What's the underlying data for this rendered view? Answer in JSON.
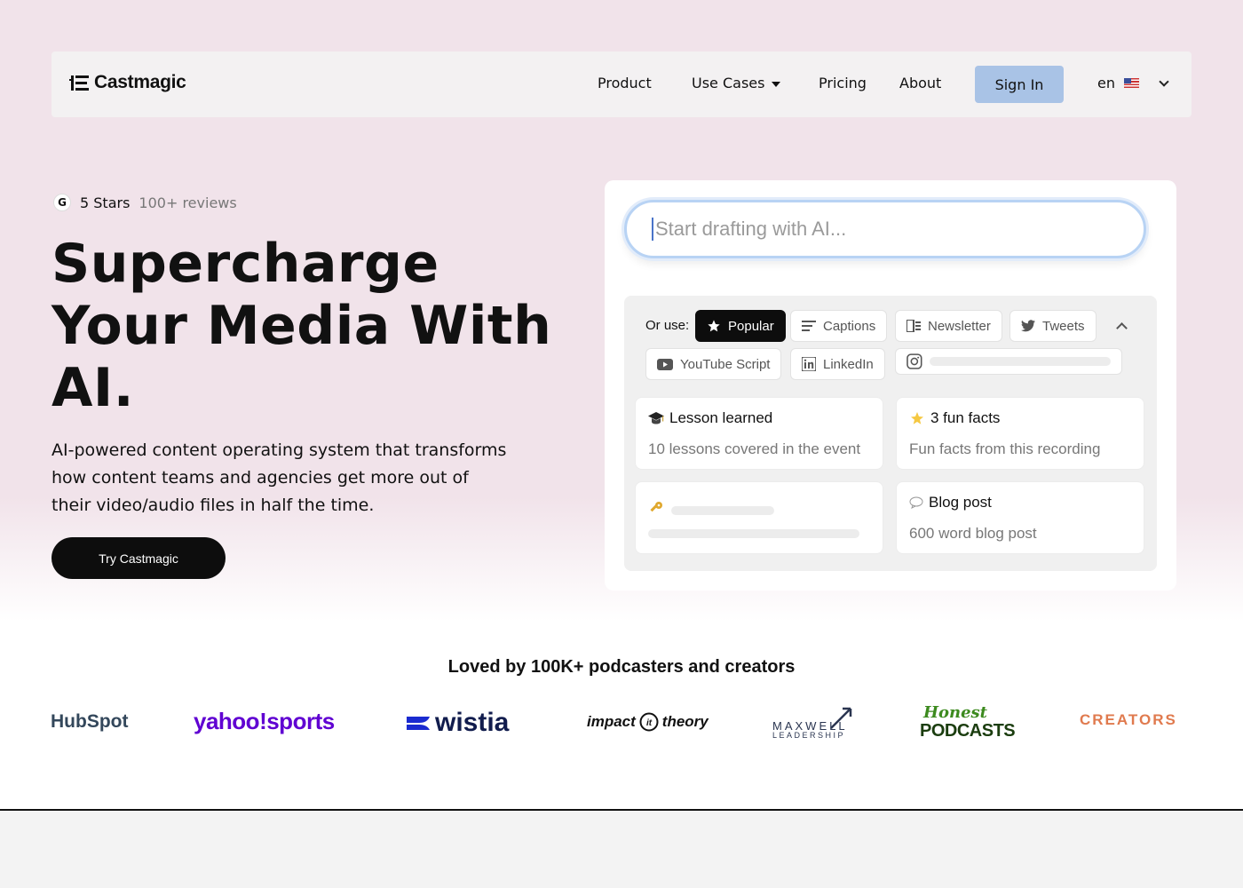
{
  "nav": {
    "brand": "Castmagic",
    "links": [
      "Product",
      "Use Cases",
      "Pricing",
      "About"
    ],
    "signin": "Sign In",
    "lang": "en"
  },
  "hero": {
    "rating_stars": "5 Stars",
    "rating_reviews": "100+ reviews",
    "headline_1": "Supercharge",
    "headline_2": "Your Media With",
    "headline_3": "AI.",
    "subtitle": "AI-powered content operating system that transforms how content teams and agencies get more out of their video/audio files in half the time.",
    "cta": "Try Castmagic"
  },
  "composer": {
    "placeholder": "Start drafting with AI...",
    "or_use": "Or use:",
    "chips": {
      "popular": "Popular",
      "captions": "Captions",
      "newsletter": "Newsletter",
      "tweets": "Tweets",
      "youtube": "YouTube Script",
      "linkedin": "LinkedIn"
    },
    "tiles": {
      "lesson_title": "Lesson learned",
      "lesson_desc": "10 lessons covered in the event",
      "funfacts_title": "3 fun facts",
      "funfacts_desc": "Fun facts from this recording",
      "blog_title": "Blog post",
      "blog_desc": "600 word blog post"
    }
  },
  "social_proof": {
    "heading": "Loved by 100K+ podcasters and creators",
    "logos": {
      "hubspot": "HubSpot",
      "yahoo": "yahoo!sports",
      "wistia": "wistia",
      "impact_1": "impact",
      "impact_2": "theory",
      "maxwell_1": "MAXWELL",
      "maxwell_2": "LEADERSHIP",
      "honest": "Honest",
      "podcasts": "PODCASTS",
      "creators": "CREATORS"
    }
  },
  "colors": {
    "hero_bg": "#f1e3ea",
    "signin_bg": "#a9c3e6",
    "cta_bg": "#0d0d0d",
    "yahoo": "#6001d2",
    "wistia": "#1a2bd0",
    "honest_green": "#3c8a1e",
    "creators": "#e07a4e"
  }
}
